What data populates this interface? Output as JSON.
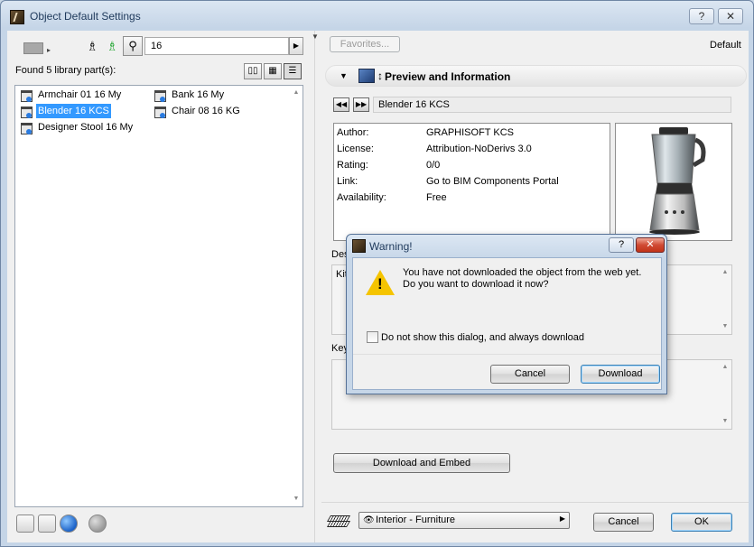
{
  "window": {
    "title": "Object Default Settings",
    "help_label": "?",
    "close_label": "✕"
  },
  "search": {
    "value": "16",
    "placeholder": ""
  },
  "library": {
    "found_text": "Found 5 library part(s):",
    "items": [
      {
        "label": "Armchair 01 16 My",
        "selected": false
      },
      {
        "label": "Bank 16 My",
        "selected": false
      },
      {
        "label": "Blender 16 KCS",
        "selected": true
      },
      {
        "label": "Chair 08 16 KG",
        "selected": false
      },
      {
        "label": "Designer Stool 16 My",
        "selected": false
      }
    ]
  },
  "toolbar": {
    "favorites_label": "Favorites...",
    "default_label": "Default"
  },
  "preview_section": {
    "title": "Preview and Information",
    "object_name": "Blender 16 KCS",
    "info": [
      {
        "key": "Author:",
        "value": "GRAPHISOFT KCS"
      },
      {
        "key": "License:",
        "value": "Attribution-NoDerivs 3.0"
      },
      {
        "key": "Rating:",
        "value": "0/0"
      },
      {
        "key": "Link:",
        "value": "Go to BIM Components Portal"
      },
      {
        "key": "Availability:",
        "value": "Free"
      }
    ],
    "description_label": "Des",
    "description_text": "Kit",
    "keywords_label": "Key"
  },
  "actions": {
    "download_embed_label": "Download and Embed",
    "layer_value": "Interior - Furniture",
    "cancel_label": "Cancel",
    "ok_label": "OK"
  },
  "dialog": {
    "title": "Warning!",
    "help_label": "?",
    "close_label": "✕",
    "message_line1": "You have not downloaded the object from the web yet.",
    "message_line2": "Do you want to download it now?",
    "checkbox_label": "Do not show this dialog, and always download",
    "checkbox_checked": false,
    "cancel_label": "Cancel",
    "download_label": "Download"
  },
  "colors": {
    "accent": "#3399ff",
    "title_text": "#1e395b",
    "warning": "#f5c400",
    "close_red": "#c23318"
  }
}
